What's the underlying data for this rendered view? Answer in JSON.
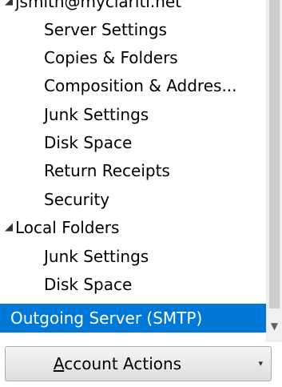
{
  "tree": {
    "account": {
      "expander": "◢",
      "name": "jsmith@myclariti.net",
      "items": [
        "Server Settings",
        "Copies & Folders",
        "Composition & Addres...",
        "Junk Settings",
        "Disk Space",
        "Return Receipts",
        "Security"
      ]
    },
    "local_folders": {
      "expander": "◢",
      "name": "Local Folders",
      "items": [
        "Junk Settings",
        "Disk Space"
      ]
    },
    "outgoing_server": "Outgoing Server (SMTP)",
    "selected": "Outgoing Server (SMTP)"
  },
  "scrollbar": {
    "down_arrow": "▼"
  },
  "account_actions": {
    "mnemonic": "A",
    "rest": "ccount Actions",
    "dropdown_glyph": "▾"
  },
  "colors": {
    "selection": "#0078d7",
    "selection_text": "#ffffff"
  }
}
